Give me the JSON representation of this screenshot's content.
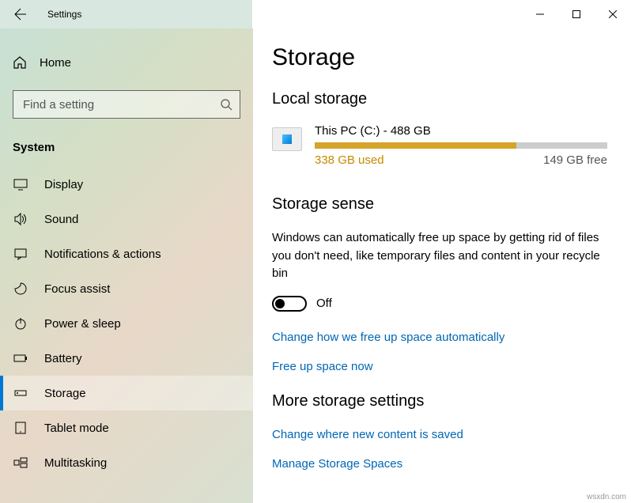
{
  "window": {
    "title": "Settings"
  },
  "sidebar": {
    "home": "Home",
    "searchPlaceholder": "Find a setting",
    "section": "System",
    "items": [
      {
        "label": "Display"
      },
      {
        "label": "Sound"
      },
      {
        "label": "Notifications & actions"
      },
      {
        "label": "Focus assist"
      },
      {
        "label": "Power & sleep"
      },
      {
        "label": "Battery"
      },
      {
        "label": "Storage"
      },
      {
        "label": "Tablet mode"
      },
      {
        "label": "Multitasking"
      }
    ]
  },
  "main": {
    "title": "Storage",
    "localStorage": {
      "heading": "Local storage",
      "driveLabel": "This PC (C:) - 488 GB",
      "used": "338 GB used",
      "free": "149 GB free"
    },
    "storageSense": {
      "heading": "Storage sense",
      "description": "Windows can automatically free up space by getting rid of files you don't need, like temporary files and content in your recycle bin",
      "toggleState": "Off",
      "link1": "Change how we free up space automatically",
      "link2": "Free up space now"
    },
    "more": {
      "heading": "More storage settings",
      "link1": "Change where new content is saved",
      "link2": "Manage Storage Spaces"
    }
  },
  "watermark": "wsxdn.com"
}
